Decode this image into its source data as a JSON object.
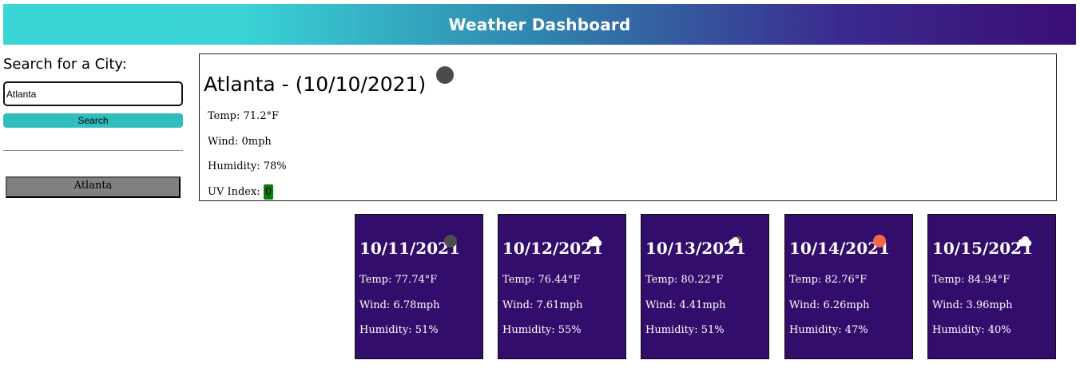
{
  "header": {
    "title": "Weather Dashboard",
    "colors": [
      "#3ad6d6",
      "#3a0e75"
    ]
  },
  "sidebar": {
    "heading": "Search for a City:",
    "input_value": "Atlanta",
    "search_label": "Search",
    "history": [
      "Atlanta"
    ]
  },
  "current": {
    "title": "Atlanta - (10/10/2021)",
    "icon": "night-clear-icon",
    "temp": "Temp: 71.2°F",
    "wind": "Wind: 0mph",
    "humidity": "Humidity: 78%",
    "uv_label": "UV Index:",
    "uv_value": "0",
    "uv_color": "#0b7a0b"
  },
  "forecast": [
    {
      "date": "10/11/2021",
      "icon": "night-clear-icon",
      "temp": "Temp: 77.74°F",
      "wind": "Wind: 6.78mph",
      "humidity": "Humidity: 51%"
    },
    {
      "date": "10/12/2021",
      "icon": "cloud-icon",
      "temp": "Temp: 76.44°F",
      "wind": "Wind: 7.61mph",
      "humidity": "Humidity: 55%"
    },
    {
      "date": "10/13/2021",
      "icon": "cloudy-night-icon",
      "temp": "Temp: 80.22°F",
      "wind": "Wind: 4.41mph",
      "humidity": "Humidity: 51%"
    },
    {
      "date": "10/14/2021",
      "icon": "sun-icon",
      "temp": "Temp: 82.76°F",
      "wind": "Wind: 6.26mph",
      "humidity": "Humidity: 47%"
    },
    {
      "date": "10/15/2021",
      "icon": "cloud-icon",
      "temp": "Temp: 84.94°F",
      "wind": "Wind: 3.96mph",
      "humidity": "Humidity: 40%"
    }
  ],
  "forecast_color": "#330d6b"
}
